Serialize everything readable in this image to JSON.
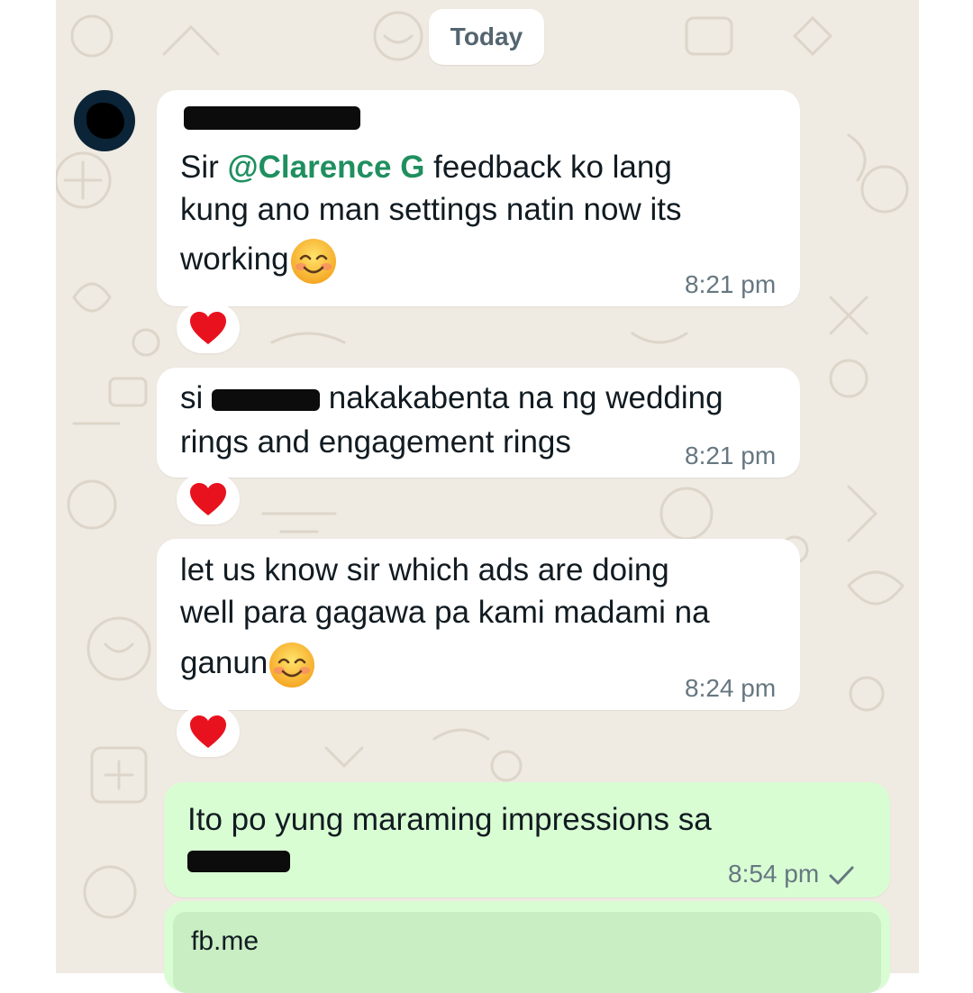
{
  "date_divider": "Today",
  "messages": [
    {
      "direction": "incoming",
      "text_parts": {
        "prefix": "Sir ",
        "mention": "@Clarence G",
        "line1_rest": " feedback ko lang",
        "line2": "kung ano man settings natin now its",
        "line3": "working"
      },
      "emoji": "smiling-face-emoji",
      "time": "8:21 pm",
      "reaction": "red-heart"
    },
    {
      "direction": "incoming",
      "text_parts": {
        "prefix": "si ",
        "line1_rest": " nakakabenta na ng wedding",
        "line2": "rings and engagement rings"
      },
      "time": "8:21 pm",
      "reaction": "red-heart"
    },
    {
      "direction": "incoming",
      "text_parts": {
        "line1": "let us know sir which ads are doing",
        "line2": "well para gagawa pa kami madami na",
        "line3": "ganun"
      },
      "emoji": "smiling-face-emoji",
      "time": "8:24 pm",
      "reaction": "red-heart"
    },
    {
      "direction": "outgoing",
      "text_parts": {
        "line1": "Ito po yung maraming impressions sa"
      },
      "time": "8:54 pm",
      "status": "sent-check"
    }
  ],
  "link_preview": {
    "domain": "fb.me"
  },
  "colors": {
    "wallpaper": "#efeae2",
    "incoming_bubble": "#ffffff",
    "outgoing_bubble": "#d9fdd3",
    "mention": "#1f8f5f",
    "heart": "#e8121e"
  }
}
